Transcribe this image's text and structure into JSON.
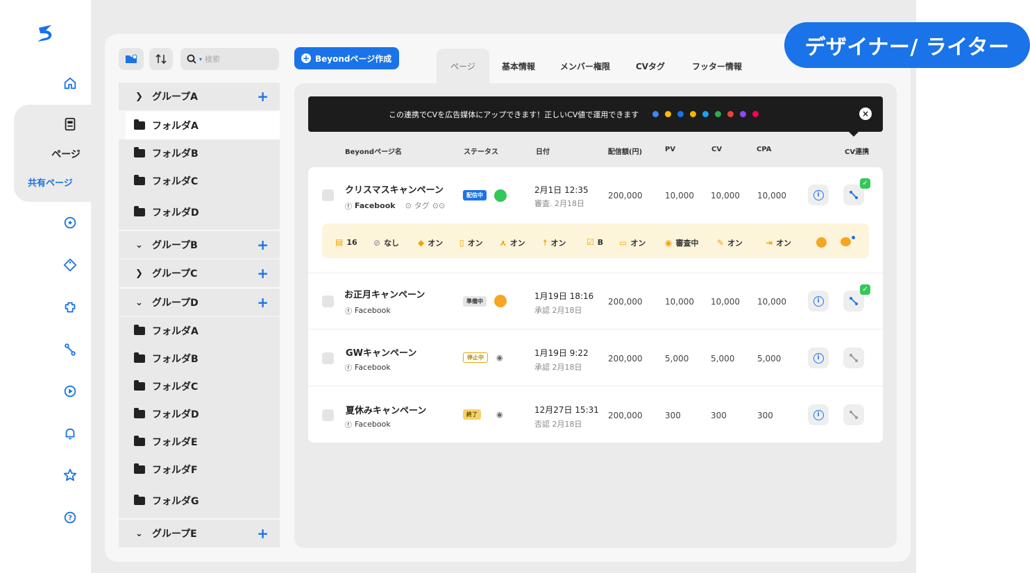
{
  "rail": {
    "page_label": "ページ",
    "shared_label": "共有ページ"
  },
  "toolbar": {
    "search_placeholder": "検索",
    "create_label": "Beyondページ作成"
  },
  "sidebar": {
    "groups": [
      {
        "label": "グループA",
        "expanded": false
      },
      {
        "label": "グループB",
        "expanded": true
      },
      {
        "label": "グループC",
        "expanded": false
      },
      {
        "label": "グループD",
        "expanded": true
      },
      {
        "label": "グループE",
        "expanded": true
      }
    ],
    "group_a_folders": [
      "フォルダA",
      "フォルダB",
      "フォルダC",
      "フォルダD"
    ],
    "group_d_folders": [
      "フォルダA",
      "フォルダB",
      "フォルダC",
      "フォルダD",
      "フォルダE",
      "フォルダF",
      "フォルダG"
    ]
  },
  "tabs": [
    "ページ",
    "基本情報",
    "メンバー権限",
    "CVタグ",
    "フッター情報"
  ],
  "banner": {
    "text": "この連携でCVを広告媒体にアップできます！正しいCV値で運用できます",
    "brand_colors": [
      "#4285f4",
      "#fbbc04",
      "#1a73e8",
      "#f4b400",
      "#1da1f2",
      "#34a853",
      "#ea4335",
      "#9146ff",
      "#ff0050"
    ]
  },
  "table": {
    "headers": [
      "Beyondページ名",
      "ステータス",
      "日付",
      "配信額(円)",
      "PV",
      "CV",
      "CPA",
      "CV連携"
    ],
    "rows": [
      {
        "name": "クリスマスキャンペーン",
        "platform": "Facebook",
        "tag": "タグ",
        "status": "配信中",
        "status_color": "#1a73e8",
        "dot_color": "#34c759",
        "date": "2月1日 12:35",
        "review": "審査. 2月18日",
        "spend": "200,000",
        "pv": "10,000",
        "cv": "10,000",
        "cpa": "10,000",
        "linked": true
      },
      {
        "name": "お正月キャンペーン",
        "platform": "Facebook",
        "status": "準備中",
        "status_color": "#555555",
        "dot_color": "#f5a623",
        "date": "1月19日 18:16",
        "review": "承認 2月18日",
        "spend": "200,000",
        "pv": "10,000",
        "cv": "10,000",
        "cpa": "10,000",
        "linked": true
      },
      {
        "name": "GWキャンペーン",
        "platform": "Facebook",
        "status": "停止中",
        "status_color": "#e6a700",
        "date": "1月19日 9:22",
        "review": "承認 2月18日",
        "spend": "200,000",
        "pv": "5,000",
        "cv": "5,000",
        "cpa": "5,000",
        "linked": false
      },
      {
        "name": "夏休みキャンペーン",
        "platform": "Facebook",
        "status": "終了",
        "status_color": "#f5d36a",
        "date": "12月27日 15:31",
        "review": "否認 2月18日",
        "spend": "200,000",
        "pv": "300",
        "cv": "300",
        "cpa": "300",
        "linked": false
      }
    ]
  },
  "strip": {
    "items": [
      "16",
      "なし",
      "オン",
      "オン",
      "オン",
      "オン",
      "B",
      "オン",
      "審査中",
      "オン",
      "オン"
    ]
  },
  "role_badge": "デザイナー/ ライター"
}
